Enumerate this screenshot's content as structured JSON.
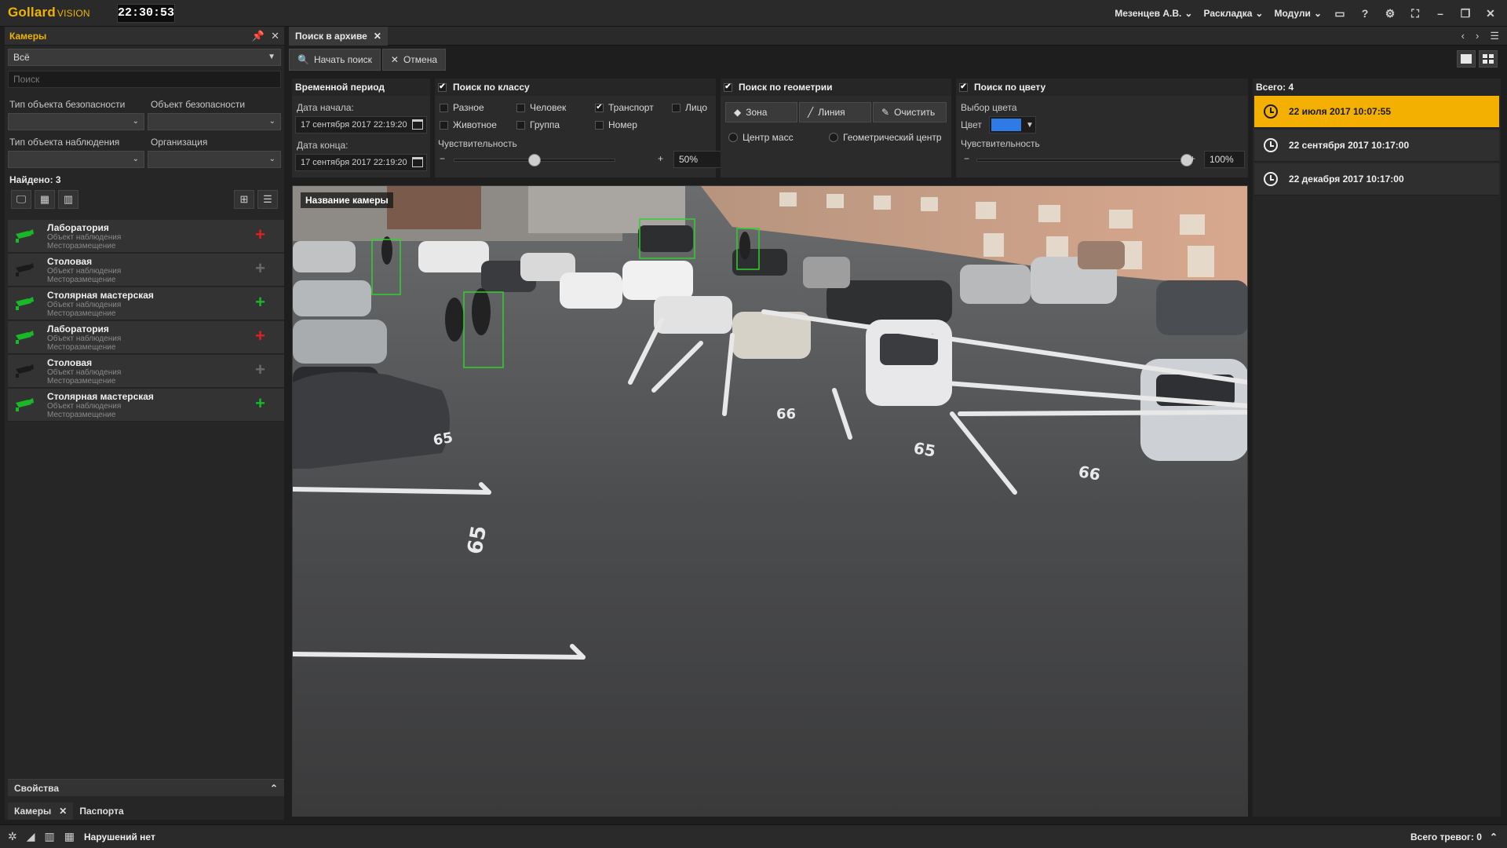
{
  "app": {
    "logo_main": "Gollard",
    "logo_sub": "VISION",
    "clock": "22:30:53",
    "user_menu": "Мезенцев А.В.",
    "layout_menu": "Раскладка",
    "modules_menu": "Модули"
  },
  "left_panel": {
    "title": "Камеры",
    "filter_select": "Всё",
    "search_placeholder": "Поиск",
    "security_type_label": "Тип объекта безопасности",
    "security_object_label": "Объект безопасности",
    "observation_type_label": "Тип объекта наблюдения",
    "organization_label": "Организация",
    "found": "Найдено: 3",
    "cameras": [
      {
        "name": "Лаборатория",
        "type": "Объект наблюдения",
        "place": "Месторазмещение",
        "icon_color": "#19b828",
        "plus_color": "#e02020"
      },
      {
        "name": "Столовая",
        "type": "Объект наблюдения",
        "place": "Месторазмещение",
        "icon_color": "#3a3a3a",
        "plus_color": "#777777"
      },
      {
        "name": "Столярная мастерская",
        "type": "Объект наблюдения",
        "place": "Месторазмещение",
        "icon_color": "#19b828",
        "plus_color": "#19b828"
      },
      {
        "name": "Лаборатория",
        "type": "Объект наблюдения",
        "place": "Месторазмещение",
        "icon_color": "#19b828",
        "plus_color": "#e02020"
      },
      {
        "name": "Столовая",
        "type": "Объект наблюдения",
        "place": "Месторазмещение",
        "icon_color": "#3a3a3a",
        "plus_color": "#777777"
      },
      {
        "name": "Столярная мастерская",
        "type": "Объект наблюдения",
        "place": "Месторазмещение",
        "icon_color": "#19b828",
        "plus_color": "#19b828"
      }
    ],
    "properties_label": "Свойства",
    "tab_cameras": "Камеры",
    "tab_passports": "Паспорта"
  },
  "main": {
    "tab_title": "Поиск в архиве",
    "start_search": "Начать поиск",
    "cancel": "Отмена",
    "time_period": {
      "title": "Временной период",
      "start_label": "Дата начала:",
      "start_value": "17 сентября 2017   22:19:20",
      "end_label": "Дата конца:",
      "end_value": "17 сентября 2017   22:19:20"
    },
    "class_search": {
      "title": "Поиск по классу",
      "misc": "Разное",
      "person": "Человек",
      "transport": "Транспорт",
      "face": "Лицо",
      "animal": "Животное",
      "group": "Группа",
      "number": "Номер",
      "sensitivity_label": "Чувствительность",
      "sensitivity_value": "50%",
      "sensitivity_level": 0.5
    },
    "geometry_search": {
      "title": "Поиск по геометрии",
      "zone": "Зона",
      "line": "Линия",
      "clear": "Очистить",
      "mass_center": "Центр масс",
      "geo_center": "Геометрический центр"
    },
    "color_search": {
      "title": "Поиск по цвету",
      "choose_label": "Выбор цвета",
      "color_label": "Цвет",
      "color_value": "#2e7ae6",
      "sensitivity_label": "Чувствительность",
      "sensitivity_value": "100%",
      "sensitivity_level": 1.0
    },
    "camera_name": "Название камеры",
    "slider_minus": "−",
    "slider_plus": "+"
  },
  "results": {
    "total": "Всего: 4",
    "items": [
      "22 июля 2017 10:07:55",
      "22 сентября 2017 10:17:00",
      "22 декабря 2017 10:17:00"
    ],
    "accent": "#f3b000"
  },
  "status": {
    "violations": "Нарушений нет",
    "alarms": "Всего тревог: 0"
  },
  "parking_marks": [
    "66",
    "65",
    "65",
    "65",
    "66"
  ]
}
